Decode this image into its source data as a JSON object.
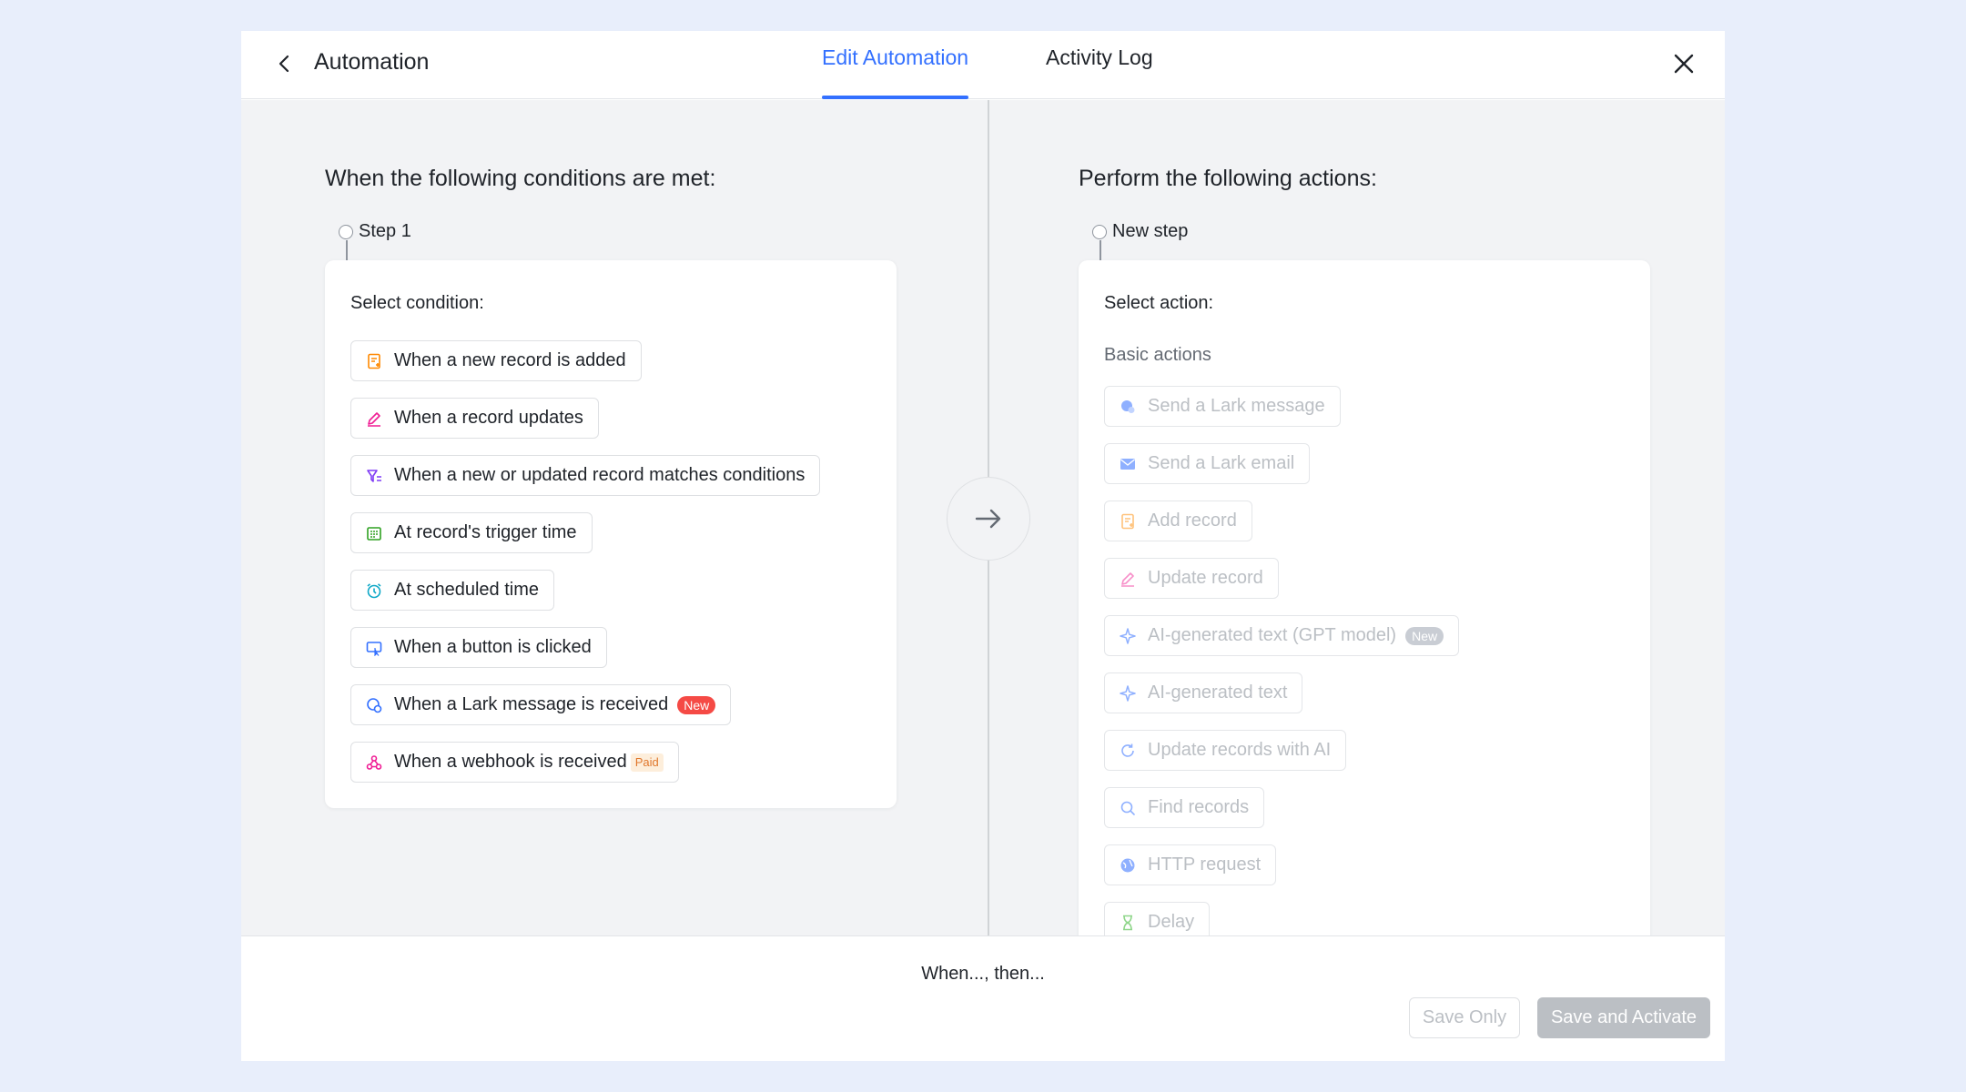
{
  "header": {
    "title": "Automation",
    "tabs": [
      {
        "label": "Edit Automation",
        "active": true
      },
      {
        "label": "Activity Log",
        "active": false
      }
    ]
  },
  "left": {
    "section_title": "When the following conditions are met:",
    "step_label": "Step 1",
    "card_label": "Select condition:",
    "conditions": [
      {
        "label": "When a new record is added",
        "icon": "record-add-icon",
        "color": "#ff8800"
      },
      {
        "label": "When a record updates",
        "icon": "pencil-icon",
        "color": "#f01d94"
      },
      {
        "label": "When a new or updated record matches conditions",
        "icon": "filter-icon",
        "color": "#7f3bf5"
      },
      {
        "label": "At record's trigger time",
        "icon": "calendar-icon",
        "color": "#2ea121"
      },
      {
        "label": "At scheduled time",
        "icon": "alarm-clock-icon",
        "color": "#0fa8c7"
      },
      {
        "label": "When a button is clicked",
        "icon": "button-click-icon",
        "color": "#3370ff"
      },
      {
        "label": "When a Lark message is received",
        "icon": "message-icon",
        "color": "#3370ff",
        "badge": "New"
      },
      {
        "label": "When a webhook is received",
        "icon": "webhook-icon",
        "color": "#f01d94",
        "badge": "Paid"
      }
    ]
  },
  "right": {
    "section_title": "Perform the following actions:",
    "step_label": "New step",
    "card_label": "Select action:",
    "group_label": "Basic actions",
    "actions": [
      {
        "label": "Send a Lark message",
        "icon": "lark-message-icon",
        "color": "#3370ff"
      },
      {
        "label": "Send a Lark email",
        "icon": "mail-icon",
        "color": "#3370ff"
      },
      {
        "label": "Add record",
        "icon": "record-add-icon",
        "color": "#ff8800"
      },
      {
        "label": "Update record",
        "icon": "pencil-icon",
        "color": "#f01d94"
      },
      {
        "label": "AI-generated text (GPT model)",
        "icon": "sparkle-icon",
        "color": "#3370ff",
        "badge": "New"
      },
      {
        "label": "AI-generated text",
        "icon": "sparkle-icon",
        "color": "#3370ff"
      },
      {
        "label": "Update records with AI",
        "icon": "refresh-icon",
        "color": "#3370ff"
      },
      {
        "label": "Find records",
        "icon": "search-icon",
        "color": "#3370ff"
      },
      {
        "label": "HTTP request",
        "icon": "globe-icon",
        "color": "#3370ff"
      },
      {
        "label": "Delay",
        "icon": "hourglass-icon",
        "color": "#2ea121"
      }
    ]
  },
  "footer": {
    "summary": "When..., then...",
    "save_only": "Save Only",
    "save_activate": "Save and Activate"
  }
}
